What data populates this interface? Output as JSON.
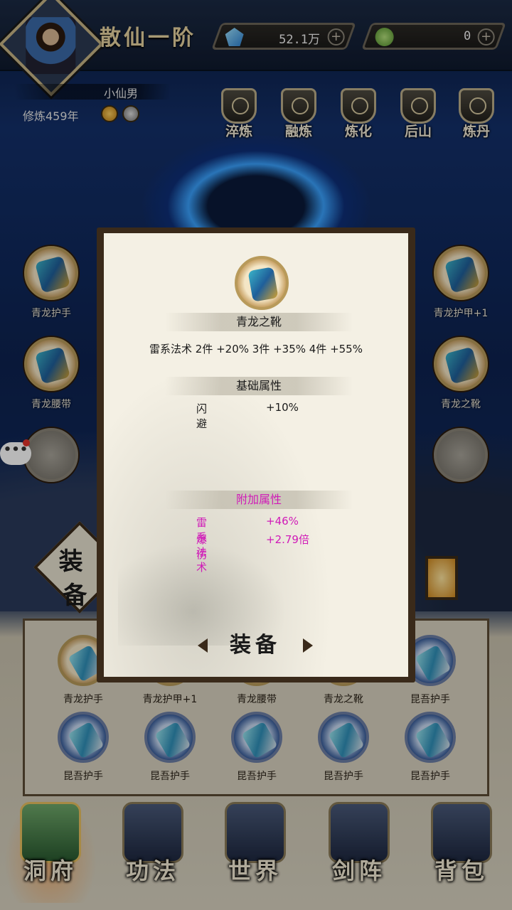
{
  "header": {
    "rank": "散仙一阶",
    "currency1": {
      "value": "52.1万",
      "icon": "blue-crystal-icon",
      "add": "+"
    },
    "currency2": {
      "value": "0",
      "icon": "jade-icon",
      "add": "+"
    },
    "player_name": "小仙男",
    "cultivation": "修炼459年"
  },
  "functions": [
    {
      "label": "淬炼",
      "icon": "cauldron-icon"
    },
    {
      "label": "融炼",
      "icon": "fusion-icon"
    },
    {
      "label": "炼化",
      "icon": "refine-icon"
    },
    {
      "label": "后山",
      "icon": "mountain-icon"
    },
    {
      "label": "炼丹",
      "icon": "furnace-icon"
    }
  ],
  "slots_left": [
    {
      "label": "青龙护手"
    },
    {
      "label": "青龙腰带"
    },
    {
      "label": ""
    }
  ],
  "slots_right": [
    {
      "label": "青龙护甲+1"
    },
    {
      "label": "青龙之靴"
    },
    {
      "label": ""
    }
  ],
  "chat": {
    "label": "•••"
  },
  "equip_sign": {
    "c1": "装",
    "c2": "备"
  },
  "modal": {
    "item_name": "青龙之靴",
    "set_bonus": "雷系法术 2件 +20% 3件 +35% 4件 +55%",
    "base_header": "基础属性",
    "base_attrs": [
      {
        "key": "闪避",
        "val": "+10%"
      }
    ],
    "extra_header": "附加属性",
    "extra_attrs": [
      {
        "key": "雷系法术",
        "val": "+46%"
      },
      {
        "key": "爆伤",
        "val": "+2.79倍"
      }
    ],
    "button": "装备"
  },
  "bag": {
    "row1": [
      "青龙护手",
      "青龙护甲+1",
      "青龙腰带",
      "青龙之靴",
      "昆吾护手"
    ],
    "row2": [
      "昆吾护手",
      "昆吾护手",
      "昆吾护手",
      "昆吾护手",
      "昆吾护手"
    ]
  },
  "nav": [
    {
      "label": "洞府",
      "icon": "cave-icon",
      "active": true
    },
    {
      "label": "功法",
      "icon": "book-icon"
    },
    {
      "label": "世界",
      "icon": "world-scroll-icon"
    },
    {
      "label": "剑阵",
      "icon": "sword-icon"
    },
    {
      "label": "背包",
      "icon": "bag-icon"
    }
  ],
  "colors": {
    "accent_magenta": "#d01ab8",
    "gold_frame": "#b89a5a",
    "paper": "#f4f0e4"
  }
}
